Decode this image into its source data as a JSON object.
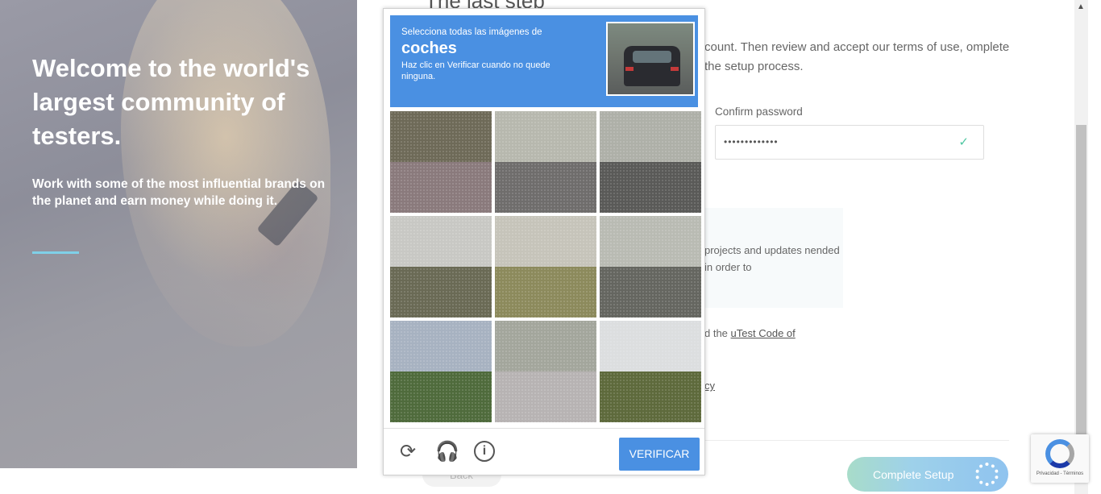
{
  "hero": {
    "title": "Welcome to the world's largest community of testers.",
    "subtitle": "Work with some of the most influential brands on the planet and earn money while doing it."
  },
  "form": {
    "title": "The last step",
    "intro": "count. Then review and accept our terms of use, omplete the setup process.",
    "confirm_password_label": "Confirm password",
    "confirm_password_value": "•••••••••••••",
    "info_text": "projects and updates nended in order to",
    "terms_prefix": "d the ",
    "terms_link": "uTest Code of",
    "privacy_link": "cy",
    "back_button": "Back",
    "complete_button": "Complete Setup"
  },
  "recaptcha_badge": {
    "text": "Privacidad - Términos"
  },
  "captcha": {
    "instruction": "Selecciona todas las imágenes de",
    "keyword": "coches",
    "hint": "Haz clic en Verificar cuando no quede ninguna.",
    "verify_label": "VERIFICAR",
    "tiles": [
      {
        "name": "guardrail",
        "sky": "#6e6a58",
        "ground": "#8a7a7c"
      },
      {
        "name": "palms",
        "sky": "#b7b8ae",
        "ground": "#6f6d6c"
      },
      {
        "name": "highway-cars",
        "sky": "#aeb0a8",
        "ground": "#5a5a58"
      },
      {
        "name": "street-lights",
        "sky": "#c8c8c4",
        "ground": "#6a6a55"
      },
      {
        "name": "bridge",
        "sky": "#c6c4ba",
        "ground": "#8c8a5c"
      },
      {
        "name": "traffic-light-car",
        "sky": "#b9bbb3",
        "ground": "#656660"
      },
      {
        "name": "overpass-fence",
        "sky": "#a7b2c1",
        "ground": "#4f6b3c"
      },
      {
        "name": "car-on-road",
        "sky": "#a3a69c",
        "ground": "#b7b3b3"
      },
      {
        "name": "empty-road",
        "sky": "#dcdedf",
        "ground": "#5e6a3c"
      }
    ],
    "colors": {
      "accent": "#4a90e2"
    }
  }
}
